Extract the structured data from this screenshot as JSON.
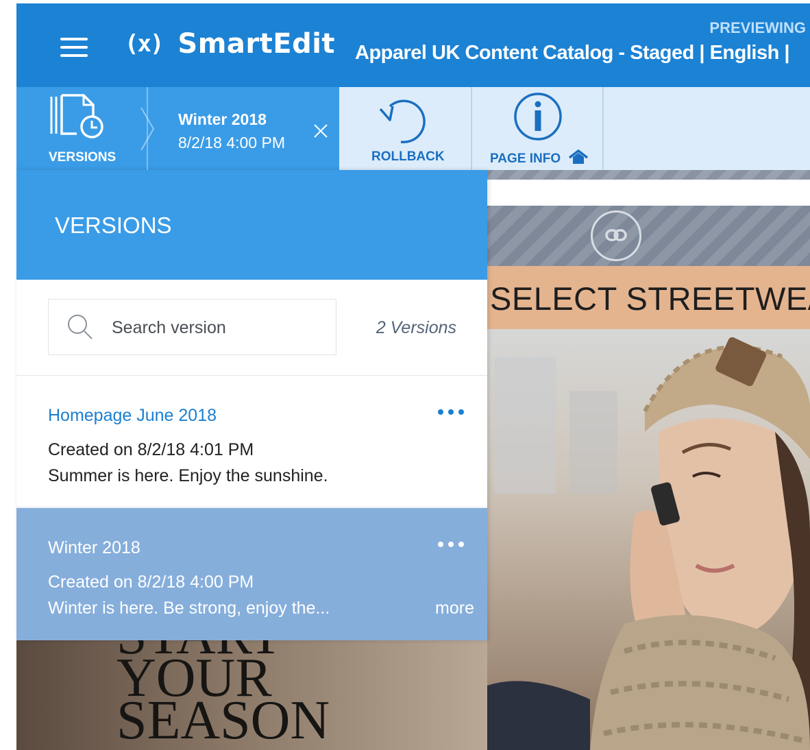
{
  "header": {
    "logo_symbol": "(x)",
    "app_name": "SmartEdit",
    "preview_label": "PREVIEWING",
    "catalog_title": "Apparel UK Content Catalog - Staged | English |"
  },
  "toolbar": {
    "versions_label": "VERSIONS",
    "current_version_name": "Winter 2018",
    "current_version_date": "8/2/18 4:00 PM",
    "rollback_label": "ROLLBACK",
    "page_info_label": "PAGE INFO"
  },
  "panel": {
    "title": "VERSIONS",
    "search_placeholder": "Search version",
    "version_count": "2 Versions",
    "items": [
      {
        "name": "Homepage June 2018",
        "created": "Created on 8/2/18 4:01 PM",
        "description": "Summer is here. Enjoy the sunshine."
      },
      {
        "name": "Winter 2018",
        "created": "Created on 8/2/18 4:00 PM",
        "description": "Winter is here. Be strong, enjoy the...",
        "more_label": "more"
      }
    ]
  },
  "preview": {
    "banner_text": "SELECT STREETWEAR",
    "hero_lines": [
      "START",
      "YOUR",
      "SEASON"
    ]
  },
  "icons": {
    "menu": "hamburger-icon",
    "versions": "document-clock-icon",
    "close": "close-icon",
    "rollback": "undo-circle-icon",
    "page_info": "info-circle-icon",
    "home": "home-icon",
    "link": "link-icon",
    "search": "search-icon",
    "more": "ellipsis-icon"
  },
  "colors": {
    "header": "#1c82d4",
    "panel_header": "#3a9ce7",
    "toolbar": "#dcecfa",
    "selected_item": "#86aedb",
    "link_text": "#1b7fd0"
  }
}
